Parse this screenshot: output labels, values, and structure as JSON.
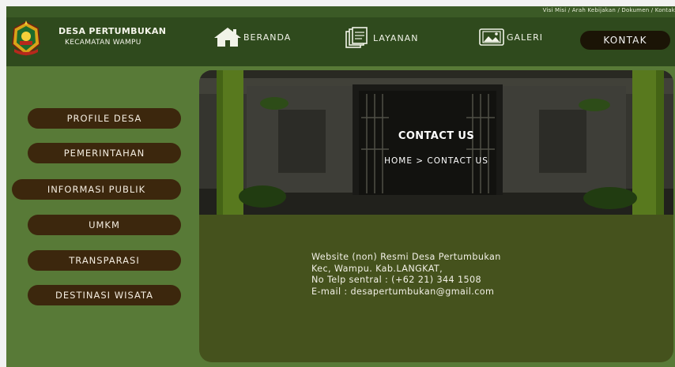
{
  "topbar": {
    "links": "Visi Misi / Arah Kebijakan / Dokumen / Kontak"
  },
  "brand": {
    "name": "DESA PERTUMBUKAN",
    "subtitle": "KECAMATAN WAMPU"
  },
  "nav": {
    "beranda": "BERANDA",
    "layanan": "LAYANAN",
    "galeri": "GALERI",
    "kontak": "KONTAK"
  },
  "sidebar": {
    "items": [
      {
        "label": "PROFILE DESA"
      },
      {
        "label": "PEMERINTAHAN"
      },
      {
        "label": "INFORMASI PUBLIK"
      },
      {
        "label": "UMKM"
      },
      {
        "label": "TRANSPARASI"
      },
      {
        "label": "DESTINASI WISATA"
      }
    ]
  },
  "hero": {
    "title": "CONTACT US",
    "breadcrumb": "HOME > CONTACT US"
  },
  "contact": {
    "line1": "Website (non) Resmi Desa Pertumbukan",
    "line2": "Kec, Wampu. Kab.LANGKAT,",
    "line3": "No Telp sentral : (+62 21) 344 1508",
    "line4": "E-mail : desapertumbukan@gmail.com"
  },
  "colors": {
    "header": "#2f4a1d",
    "body": "#587a37",
    "panel": "#45521d",
    "button": "#3c270d",
    "kontak": "#1b1406"
  }
}
